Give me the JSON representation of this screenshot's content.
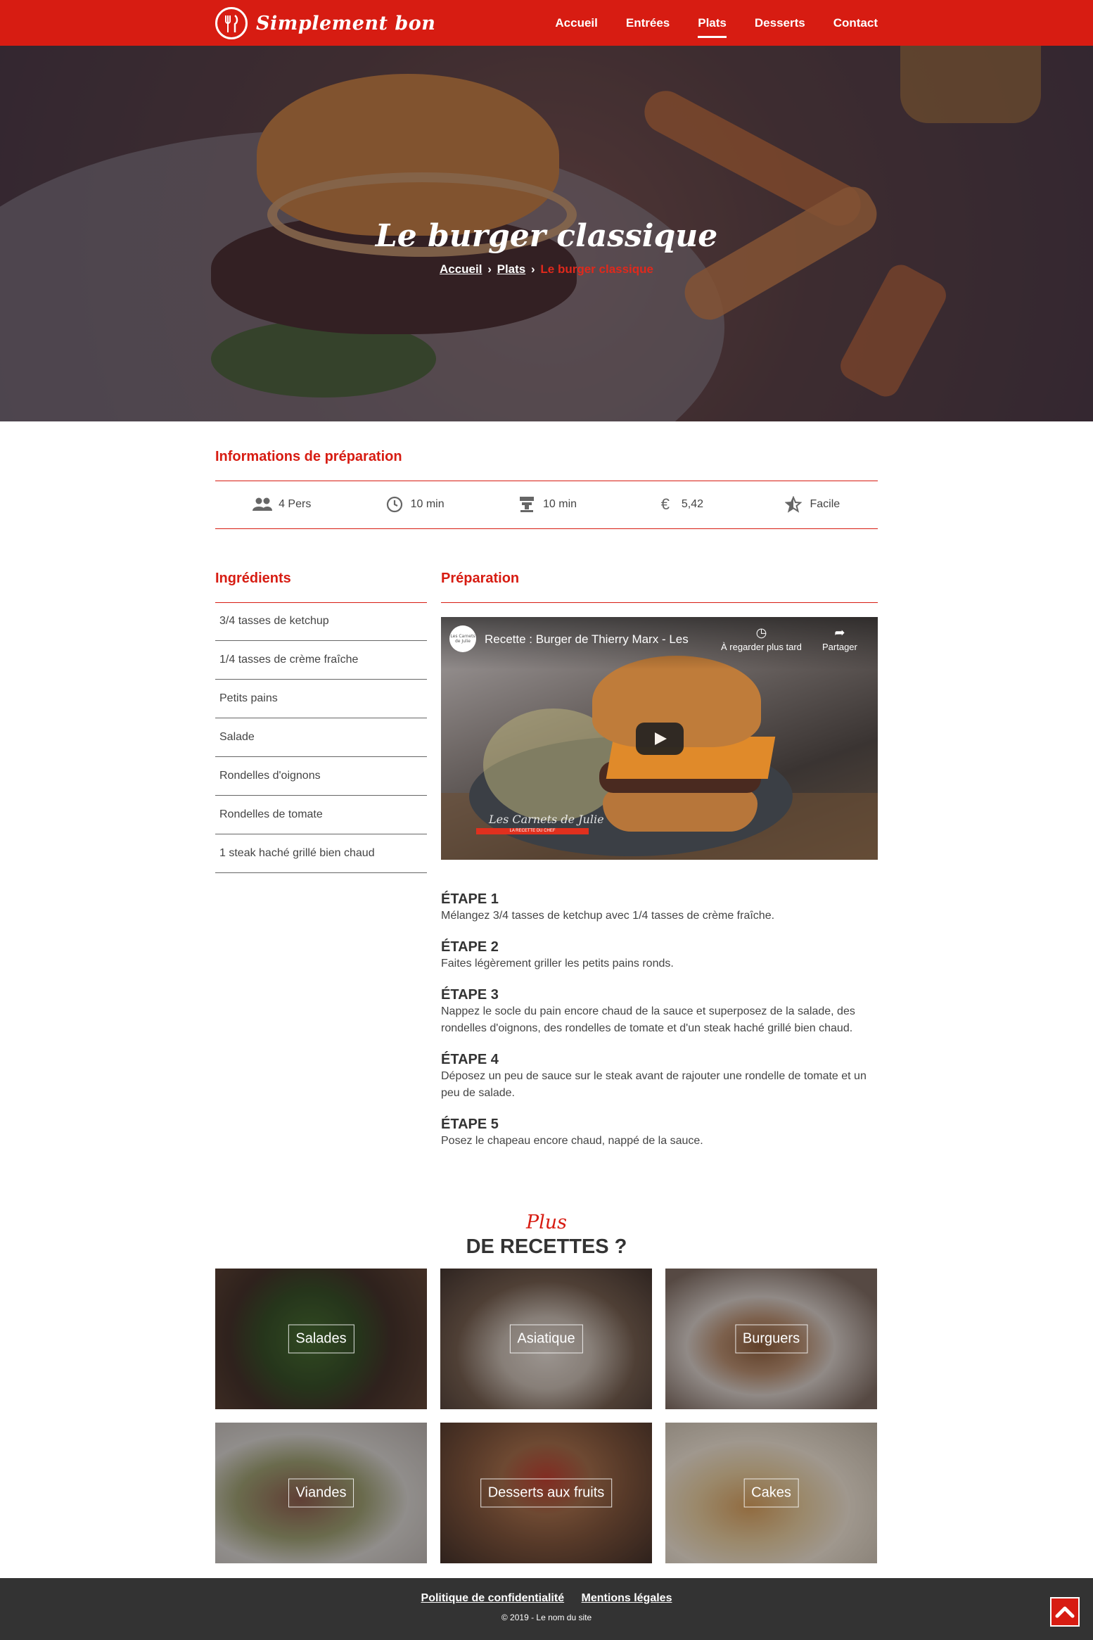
{
  "brand": {
    "name": "Simplement bon"
  },
  "nav": {
    "items": [
      {
        "label": "Accueil"
      },
      {
        "label": "Entrées"
      },
      {
        "label": "Plats"
      },
      {
        "label": "Desserts"
      },
      {
        "label": "Contact"
      }
    ],
    "active": "Plats"
  },
  "hero": {
    "title": "Le burger classique",
    "breadcrumb": {
      "home": "Accueil",
      "category": "Plats",
      "current": "Le burger classique"
    }
  },
  "infos": {
    "title": "Informations de préparation",
    "items": [
      {
        "icon": "people-icon",
        "value": "4 Pers"
      },
      {
        "icon": "clock-icon",
        "value": "10 min"
      },
      {
        "icon": "cooking-icon",
        "value": "10 min"
      },
      {
        "icon": "euro-icon",
        "value": "5,42"
      },
      {
        "icon": "star-icon",
        "value": "Facile"
      }
    ]
  },
  "ingredients": {
    "title": "Ingrédients",
    "items": [
      "3/4 tasses de ketchup",
      "1/4 tasses de crème fraîche",
      "Petits pains",
      "Salade",
      "Rondelles d'oignons",
      "Rondelles de tomate",
      "1 steak haché grillé bien chaud"
    ]
  },
  "preparation": {
    "title": "Préparation",
    "video": {
      "title": "Recette : Burger de Thierry Marx - Les",
      "watch_later": "À regarder plus tard",
      "share": "Partager",
      "channel": "Les Carnets de Julie",
      "logo_text": "Les Carnets de Julie",
      "band_text": "LA RECETTE DU CHEF"
    },
    "steps": [
      {
        "title": "ÉTAPE 1",
        "text": "Mélangez 3/4 tasses de ketchup avec 1/4 tasses de crème fraîche."
      },
      {
        "title": "ÉTAPE 2",
        "text": "Faites légèrement griller les petits pains ronds."
      },
      {
        "title": "ÉTAPE 3",
        "text": "Nappez le socle du pain encore chaud de la sauce et superposez de la salade, des rondelles d'oignons, des rondelles de tomate et d'un steak haché grillé bien chaud."
      },
      {
        "title": "ÉTAPE 4",
        "text": "Déposez un peu de sauce sur le steak avant de rajouter une rondelle de tomate et un peu de salade."
      },
      {
        "title": "ÉTAPE 5",
        "text": "Posez le chapeau encore chaud, nappé de la sauce."
      }
    ]
  },
  "more": {
    "script": "Plus",
    "title": "DE RECETTES ?",
    "cards": [
      {
        "label": "Salades"
      },
      {
        "label": "Asiatique"
      },
      {
        "label": "Burguers"
      },
      {
        "label": "Viandes"
      },
      {
        "label": "Desserts aux fruits"
      },
      {
        "label": "Cakes"
      }
    ]
  },
  "footer": {
    "links": [
      "Politique de confidentialité",
      "Mentions légales"
    ],
    "copyright": "© 2019 - Le nom du site"
  },
  "colors": {
    "brand_red": "#d71c12",
    "footer": "#333333"
  }
}
